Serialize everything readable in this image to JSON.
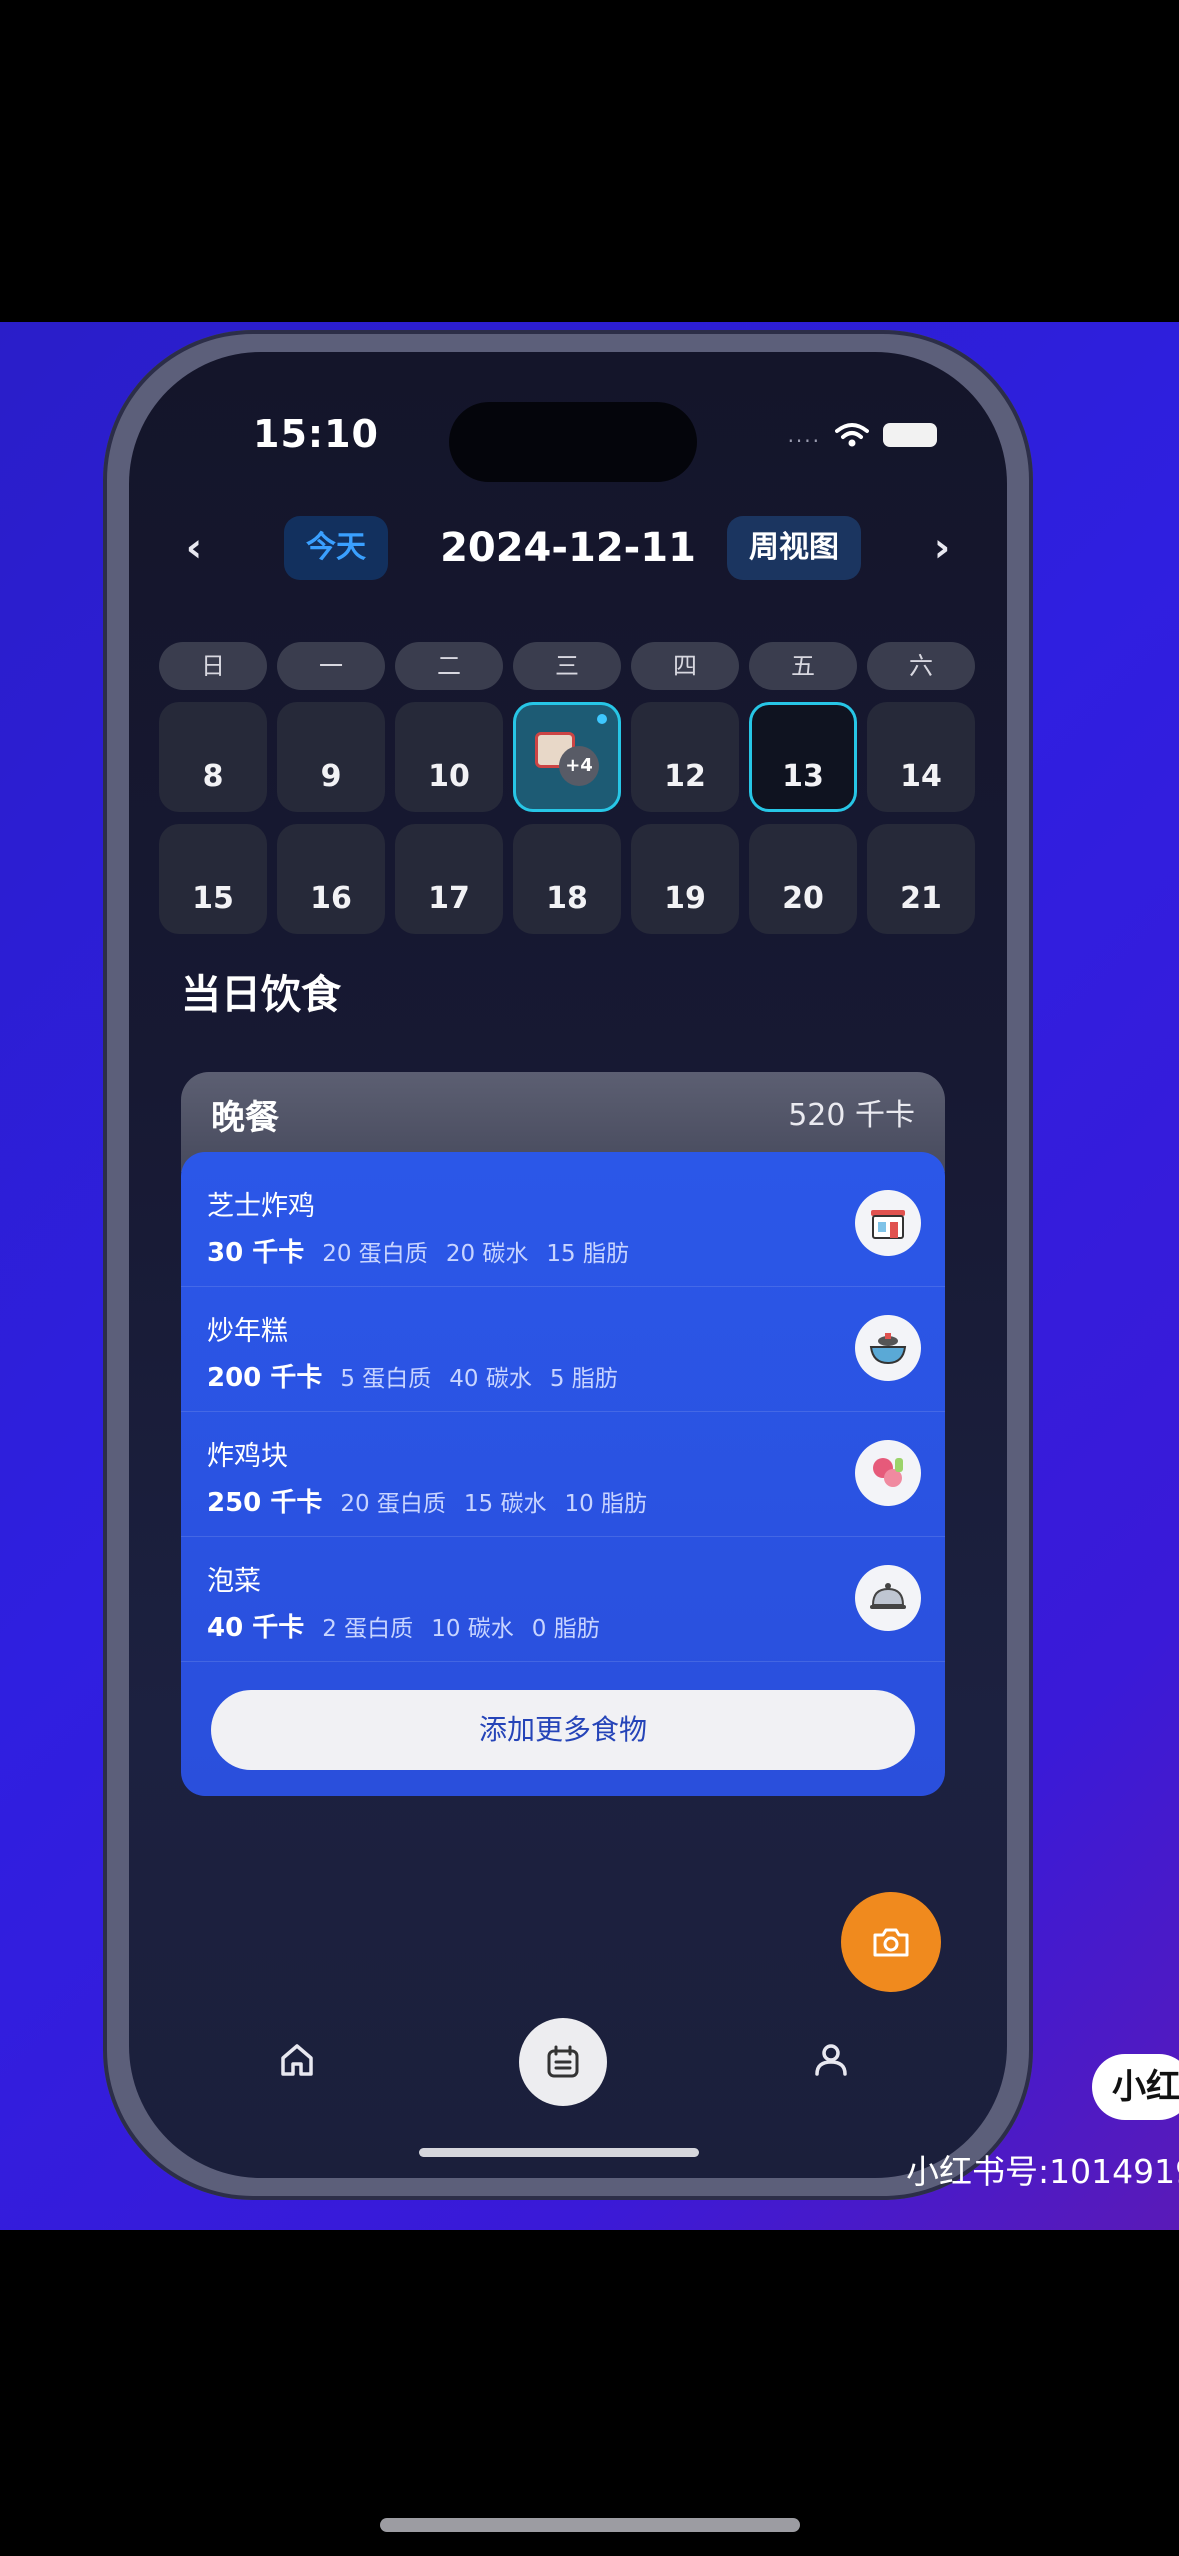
{
  "status": {
    "time": "15:10",
    "signal": "....",
    "wifi_icon": "wifi-icon",
    "battery_icon": "battery-icon"
  },
  "calendar": {
    "prev_icon": "‹",
    "next_icon": "›",
    "today_label": "今天",
    "date_title": "2024-12-11",
    "week_view_label": "周视图",
    "weekdays": [
      "日",
      "一",
      "二",
      "三",
      "四",
      "五",
      "六"
    ],
    "weeks": [
      [
        "8",
        "9",
        "10",
        "11",
        "12",
        "13",
        "14"
      ],
      [
        "15",
        "16",
        "17",
        "18",
        "19",
        "20",
        "21"
      ]
    ],
    "selected_day": "11",
    "selected_more_badge": "+4",
    "outlined_day": "13"
  },
  "section_title": "当日饮食",
  "meal": {
    "name": "晚餐",
    "total_kcal": "520 千卡",
    "items": [
      {
        "name": "芝士炸鸡",
        "kcal": "30 千卡",
        "protein": "20 蛋白质",
        "carbs": "20 碳水",
        "fat": "15 脂肪",
        "icon": "restaurant-icon"
      },
      {
        "name": "炒年糕",
        "kcal": "200 千卡",
        "protein": "5 蛋白质",
        "carbs": "40 碳水",
        "fat": "5 脂肪",
        "icon": "bowl-icon"
      },
      {
        "name": "炸鸡块",
        "kcal": "250 千卡",
        "protein": "20 蛋白质",
        "carbs": "15 碳水",
        "fat": "10 脂肪",
        "icon": "meat-icon"
      },
      {
        "name": "泡菜",
        "kcal": "40 千卡",
        "protein": "2 蛋白质",
        "carbs": "10 碳水",
        "fat": "0 脂肪",
        "icon": "cloche-icon"
      }
    ],
    "add_more_label": "添加更多食物"
  },
  "fab": {
    "icon": "camera-icon"
  },
  "tabbar": {
    "home_icon": "home-icon",
    "calendar_icon": "calendar-icon",
    "profile_icon": "profile-icon"
  },
  "watermark": {
    "badge": "小红",
    "account": "小红书号:1014919"
  },
  "colors": {
    "accent_blue": "#2b57e8",
    "today_blue": "#3aa0ff",
    "highlight_cyan": "#27c6e6",
    "fab_orange": "#f08a1e"
  }
}
